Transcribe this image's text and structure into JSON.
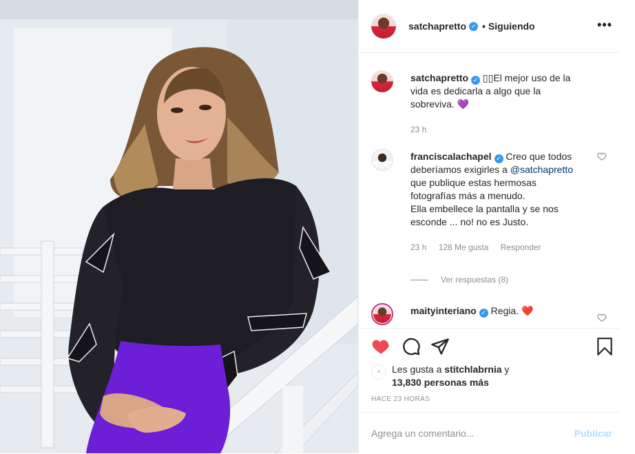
{
  "header": {
    "username": "satchapretto",
    "separator": "•",
    "follow_status": "Siguiendo",
    "more": "•••"
  },
  "caption": {
    "username": "satchapretto",
    "text": "▯▯El mejor uso de la vida es dedicarla a algo que la sobreviva. 💜",
    "time": "23 h"
  },
  "comments": [
    {
      "username": "franciscalachapel",
      "text_before": "Creo que todos deberíamos exigirles a",
      "mention": "@satchapretto",
      "text_after": "que publique estas hermosas fotografías más a menudo.",
      "text_line2": "Ella embellece la pantalla y se nos esconde ... no! no es Justo.",
      "time": "23 h",
      "likes": "128 Me gusta",
      "reply": "Responder",
      "view_replies": "Ver respuestas (8)"
    },
    {
      "username": "maityinteriano",
      "text": "Regia. ❤️"
    }
  ],
  "likes": {
    "prefix": "Les gusta a",
    "user": "stitchlabrnia",
    "joiner": "y",
    "count": "13,830 personas más"
  },
  "time_ago": "HACE 23 HORAS",
  "add_comment": {
    "placeholder": "Agrega un comentario...",
    "publish": "Publicar"
  },
  "colors": {
    "like": "#ed4956",
    "verified": "#3897f0",
    "publish_disabled": "#b2dffc",
    "muted": "#8e8e8e"
  }
}
